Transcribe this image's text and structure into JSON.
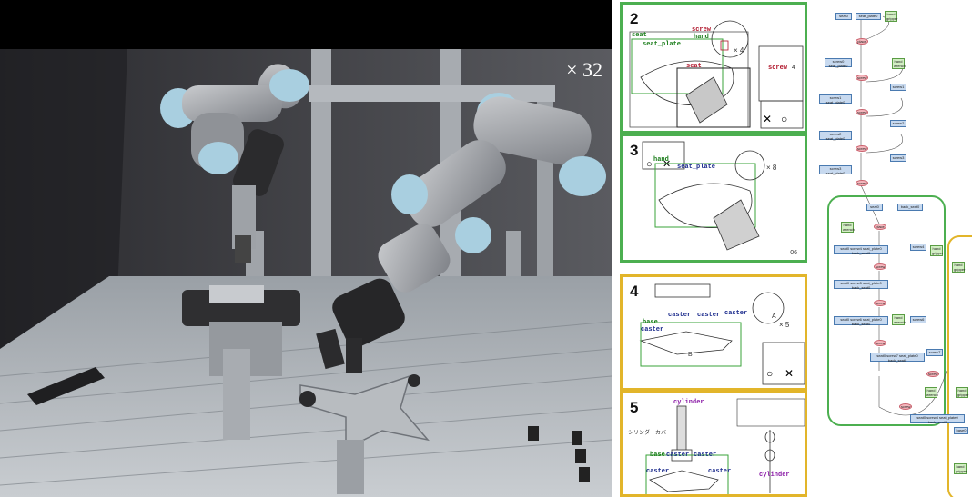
{
  "video": {
    "speed": "× 32"
  },
  "manual": {
    "pages": [
      {
        "step": "2",
        "labels": {
          "seat": "seat",
          "seat_plate": "seat_plate",
          "screw": "screw",
          "screw2": "screw",
          "hand": "hand",
          "seat2": "seat"
        },
        "quantities": [
          "× 4",
          "4"
        ]
      },
      {
        "step": "3",
        "labels": {
          "hand": "hand",
          "seat_plate": "seat_plate"
        },
        "quantities": [
          "× 8"
        ],
        "page_number": "06"
      },
      {
        "step": "4",
        "labels": {
          "base": "base",
          "caster1": "caster",
          "caster2": "caster",
          "caster3": "caster",
          "caster4": "caster"
        },
        "quantities": [
          "× 5"
        ],
        "letters": [
          "A",
          "B"
        ]
      },
      {
        "step": "5",
        "labels": {
          "cylinder1": "cylinder",
          "cylinder2": "cylinder",
          "base": "base",
          "caster1": "caster",
          "caster2": "caster",
          "caster3": "caster",
          "caster4": "caster"
        },
        "notes": [
          "シリンダーカバー"
        ]
      }
    ]
  },
  "graph": {
    "nodes": [
      {
        "id": "n1",
        "text": "seat0",
        "kind": "box"
      },
      {
        "id": "n2",
        "text": "seat_plate0",
        "kind": "box"
      },
      {
        "id": "n3",
        "text": "hand gripper",
        "kind": "hand"
      },
      {
        "id": "n4",
        "text": "place",
        "kind": "oval"
      },
      {
        "id": "n5",
        "text": "screw0 seat_plate0",
        "kind": "box"
      },
      {
        "id": "n6",
        "text": "hand wrench",
        "kind": "hand"
      },
      {
        "id": "n7",
        "text": "screw",
        "kind": "oval"
      },
      {
        "id": "n8",
        "text": "screw1",
        "kind": "box"
      },
      {
        "id": "n9",
        "text": "screw1 seat_plate0",
        "kind": "box"
      },
      {
        "id": "n10",
        "text": "screw",
        "kind": "oval"
      },
      {
        "id": "n11",
        "text": "screw2",
        "kind": "box"
      },
      {
        "id": "n12",
        "text": "screw2 seat_plate0",
        "kind": "box"
      },
      {
        "id": "n13",
        "text": "screw",
        "kind": "oval"
      },
      {
        "id": "n14",
        "text": "screw3",
        "kind": "box"
      },
      {
        "id": "n15",
        "text": "screw3 seat_plate0",
        "kind": "box"
      },
      {
        "id": "n16",
        "text": "screw",
        "kind": "oval"
      },
      {
        "id": "n17",
        "text": "seat0",
        "kind": "box"
      },
      {
        "id": "n18",
        "text": "back_seat0",
        "kind": "box"
      },
      {
        "id": "n19",
        "text": "hand wrench",
        "kind": "hand"
      },
      {
        "id": "n20",
        "text": "place",
        "kind": "oval"
      },
      {
        "id": "n21",
        "text": "seat0 screw4 seat_plate0 back_seat0",
        "kind": "box"
      },
      {
        "id": "n22",
        "text": "screw4",
        "kind": "box"
      },
      {
        "id": "n23",
        "text": "hand gripper",
        "kind": "hand"
      },
      {
        "id": "n24",
        "text": "screw",
        "kind": "oval"
      },
      {
        "id": "n25",
        "text": "seat0 screw5 seat_plate0 back_seat0",
        "kind": "box"
      },
      {
        "id": "n26",
        "text": "screw",
        "kind": "oval"
      },
      {
        "id": "n27",
        "text": "seat0 screw6 seat_plate0 back_seat0",
        "kind": "box"
      },
      {
        "id": "n28",
        "text": "screw6",
        "kind": "box"
      },
      {
        "id": "n29",
        "text": "hand wrench",
        "kind": "hand"
      },
      {
        "id": "n30",
        "text": "screw",
        "kind": "oval"
      },
      {
        "id": "n31",
        "text": "seat0 screw7 seat_plate0 back_seat0",
        "kind": "box"
      },
      {
        "id": "n32",
        "text": "screw7",
        "kind": "box"
      },
      {
        "id": "n33",
        "text": "screw",
        "kind": "oval"
      },
      {
        "id": "n34",
        "text": "hand wrench",
        "kind": "hand"
      },
      {
        "id": "n35",
        "text": "hand gripper",
        "kind": "hand"
      },
      {
        "id": "n36",
        "text": "screw",
        "kind": "oval"
      },
      {
        "id": "n37",
        "text": "seat0 screw8 seat_plate0 back_seat0",
        "kind": "box"
      },
      {
        "id": "n38",
        "text": "hand gripper",
        "kind": "hand"
      },
      {
        "id": "n39",
        "text": "base0",
        "kind": "box"
      },
      {
        "id": "n40",
        "text": "hand gripper",
        "kind": "hand"
      }
    ]
  }
}
